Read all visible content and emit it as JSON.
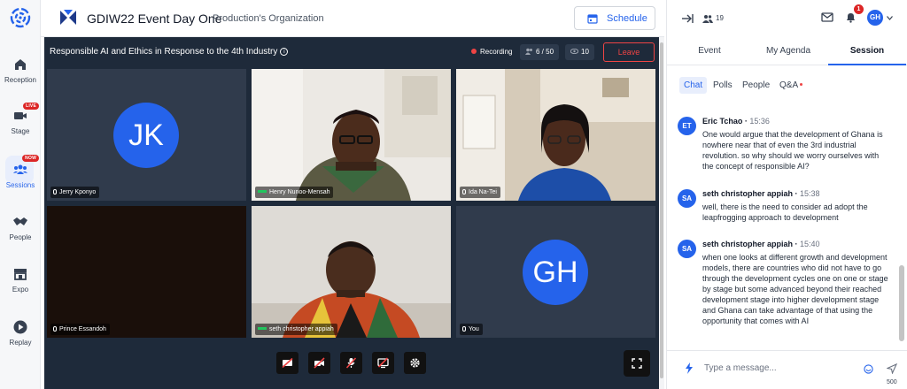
{
  "rail": {
    "items": [
      {
        "label": "Reception",
        "icon": "home-icon"
      },
      {
        "label": "Stage",
        "icon": "video-camera-icon",
        "badge": "LIVE"
      },
      {
        "label": "Sessions",
        "icon": "group-icon",
        "badge": "NOW",
        "active": true
      },
      {
        "label": "People",
        "icon": "handshake-icon"
      },
      {
        "label": "Expo",
        "icon": "storefront-icon"
      },
      {
        "label": "Replay",
        "icon": "play-circle-icon"
      }
    ]
  },
  "header": {
    "event_title": "GDIW22 Event Day One",
    "organization": "Production's Organization",
    "schedule_label": "Schedule"
  },
  "stage": {
    "session_title": "Responsible AI and Ethics in Response to the 4th Industry",
    "recording_label": "Recording",
    "participants_count": "6 / 50",
    "viewers_count": "10",
    "leave_label": "Leave",
    "tiles": [
      {
        "name": "Jerry Kponyo",
        "initials": "JK",
        "video": false
      },
      {
        "name": "Henry Nunoo-Mensah",
        "video": true
      },
      {
        "name": "Ida Na-Tei",
        "video": true
      },
      {
        "name": "Prince Essandoh",
        "video": false,
        "dark": true
      },
      {
        "name": "seth christopher appiah",
        "video": true
      },
      {
        "name": "You",
        "initials": "GH",
        "video": false
      }
    ]
  },
  "panel": {
    "attendee_count": "19",
    "notification_count": "1",
    "user_initials": "GH",
    "tabs": [
      "Event",
      "My Agenda",
      "Session"
    ],
    "active_tab": "Session",
    "subtabs": [
      "Chat",
      "Polls",
      "People",
      "Q&A"
    ],
    "active_subtab": "Chat",
    "messages": [
      {
        "initials": "ET",
        "name": "Eric Tchao",
        "time": "15:36",
        "text": "One would argue that the development of Ghana is nowhere near that of even the 3rd industrial revolution. so why should we worry ourselves with the concept of responsible AI?"
      },
      {
        "initials": "SA",
        "name": "seth christopher appiah",
        "time": "15:38",
        "text": "well, there is the need to consider ad adopt the leapfrogging approach to development"
      },
      {
        "initials": "SA",
        "name": "seth christopher appiah",
        "time": "15:40",
        "text": "when one looks at different growth and development models, there are countries who did not have to go through the development cycles one on one or stage by stage but some advanced beyond their reached development stage into higher development stage and Ghana can take advantage of that using the opportunity that comes with AI"
      }
    ],
    "input_placeholder": "Type a message...",
    "char_limit": "500"
  },
  "colors": {
    "accent": "#2563eb",
    "stage_bg": "#1e2a3a",
    "tile_bg": "#303b4c",
    "danger": "#ef4444"
  }
}
